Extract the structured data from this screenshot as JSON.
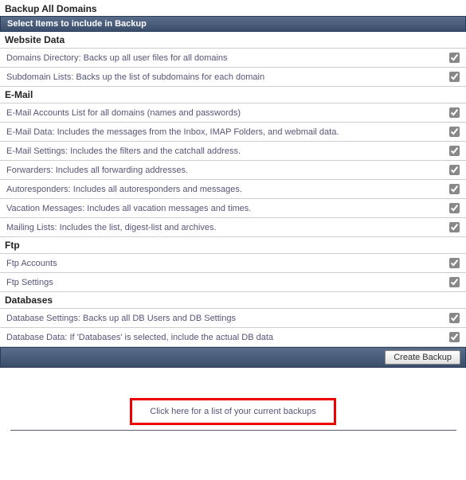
{
  "page_title": "Backup All Domains",
  "subheader": "Select Items to include in Backup",
  "sections": {
    "website_data": {
      "title": "Website Data",
      "items": [
        "Domains Directory: Backs up all user files for all domains",
        "Subdomain Lists: Backs up the list of subdomains for each domain"
      ]
    },
    "email": {
      "title": "E-Mail",
      "items": [
        "E-Mail Accounts List for all domains (names and passwords)",
        "E-Mail Data: Includes the messages from the Inbox, IMAP Folders, and webmail data.",
        "E-Mail Settings: Includes the filters and the catchall address.",
        "Forwarders: Includes all forwarding addresses.",
        "Autoresponders: Includes all autoresponders and messages.",
        "Vacation Messages: Includes all vacation messages and times.",
        "Mailing Lists: Includes the list, digest-list and archives."
      ]
    },
    "ftp": {
      "title": "Ftp",
      "items": [
        "Ftp Accounts",
        "Ftp Settings"
      ]
    },
    "databases": {
      "title": "Databases",
      "items": [
        "Database Settings: Backs up all DB Users and DB Settings",
        "Database Data: If 'Databases' is selected, include the actual DB data"
      ]
    }
  },
  "create_button": "Create Backup",
  "backups_link": "Click here for a list of your current backups"
}
